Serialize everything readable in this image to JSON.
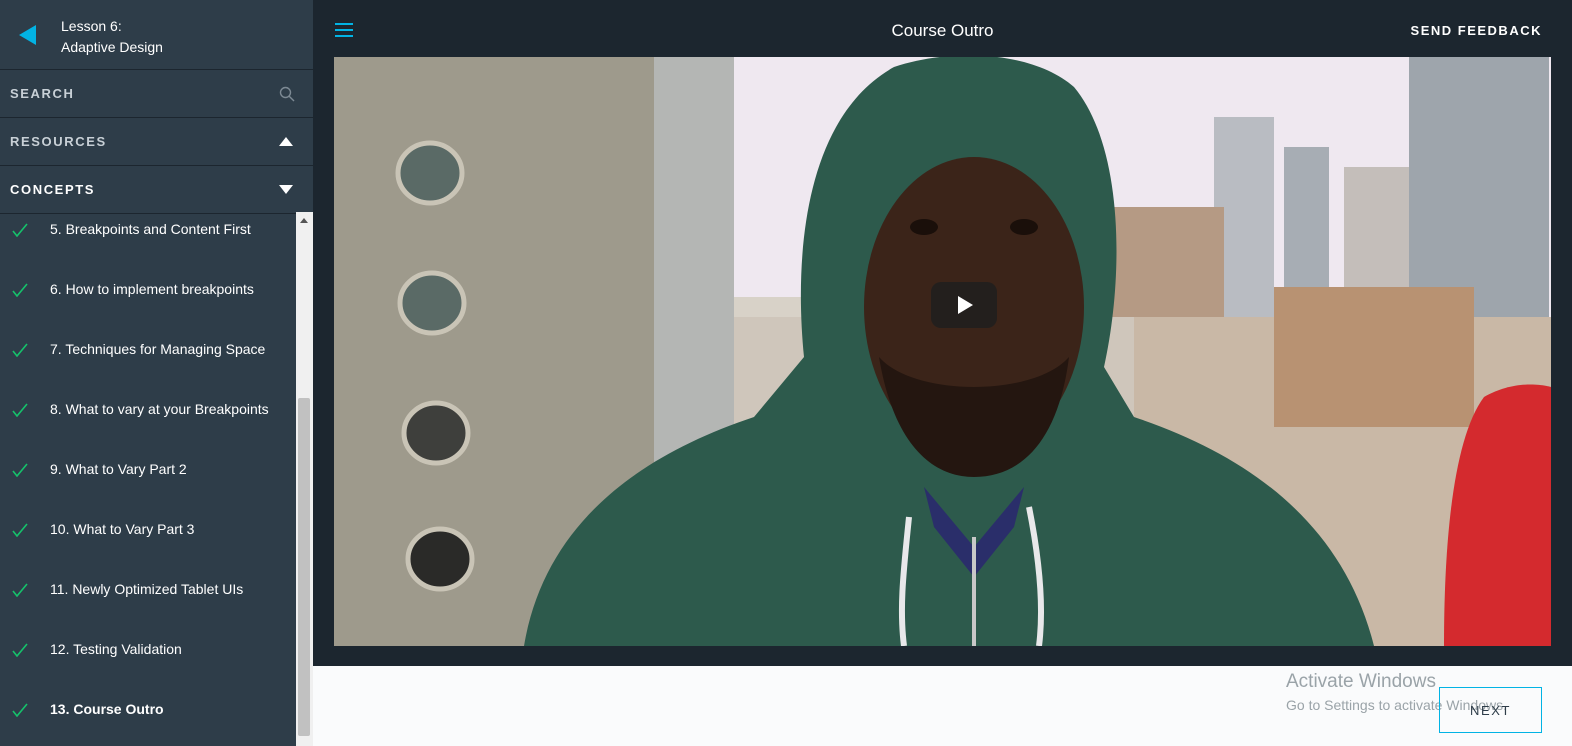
{
  "sidebar": {
    "lesson_line1": "Lesson 6:",
    "lesson_line2": "Adaptive Design",
    "search_label": "SEARCH",
    "resources_label": "RESOURCES",
    "concepts_label": "CONCEPTS",
    "concepts": [
      {
        "label": "5. Breakpoints and Content First",
        "completed": true
      },
      {
        "label": "6. How to implement breakpoints",
        "completed": true
      },
      {
        "label": "7. Techniques for Managing Space",
        "completed": true
      },
      {
        "label": "8. What to vary at your Breakpoints",
        "completed": true
      },
      {
        "label": "9. What to Vary Part 2",
        "completed": true
      },
      {
        "label": "10. What to Vary Part 3",
        "completed": true
      },
      {
        "label": "11. Newly Optimized Tablet UIs",
        "completed": true
      },
      {
        "label": "12. Testing Validation",
        "completed": true
      },
      {
        "label": "13. Course Outro",
        "completed": true,
        "current": true
      }
    ]
  },
  "header": {
    "title": "Course Outro",
    "feedback_label": "SEND FEEDBACK"
  },
  "footer": {
    "next_label": "NEXT",
    "watermark_line1": "Activate Windows",
    "watermark_line2": "Go to Settings to activate Windows."
  },
  "icons": {
    "back": "back-arrow-icon",
    "search": "search-icon",
    "menu": "hamburger-menu-icon",
    "check": "checkmark-icon",
    "play": "play-icon"
  },
  "colors": {
    "accent": "#02b3e4",
    "check": "#15c26b",
    "sidebar_bg": "#2e3d49",
    "topbar_bg": "#1c262f"
  }
}
